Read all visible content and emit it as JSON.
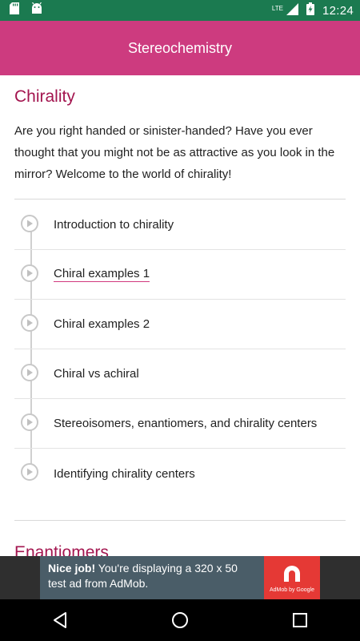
{
  "status_bar": {
    "time": "12:24",
    "network": "LTE",
    "icons": [
      "sd-card-icon",
      "android-icon",
      "signal-icon",
      "battery-charging-icon"
    ]
  },
  "app_bar": {
    "title": "Stereochemistry"
  },
  "section": {
    "title": "Chirality",
    "description": "Are you right handed or sinister-handed? Have you ever thought that you might not be as attractive as you look in the mirror? Welcome to the world of chirality!",
    "lessons": [
      {
        "label": "Introduction to chirality"
      },
      {
        "label": "Chiral examples 1"
      },
      {
        "label": "Chiral examples 2"
      },
      {
        "label": "Chiral vs achiral"
      },
      {
        "label": "Stereoisomers, enantiomers, and chirality centers"
      },
      {
        "label": "Identifying chirality centers"
      }
    ]
  },
  "next_section": {
    "title": "Enantiomers"
  },
  "ad": {
    "headline": "Nice job!",
    "body": "You're displaying a 320 x 50 test ad from AdMob.",
    "logo_caption": "AdMob by Google"
  },
  "colors": {
    "status_bar": "#1b7a50",
    "app_bar": "#cd3b7f",
    "accent_title": "#a3154f",
    "ad_background": "#4a5d68",
    "ad_logo": "#e53935"
  }
}
